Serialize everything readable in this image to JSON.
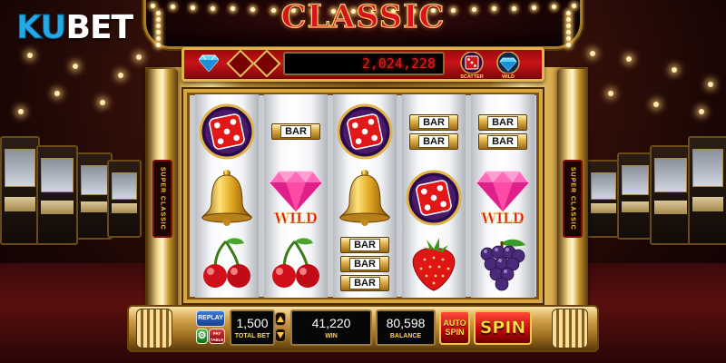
{
  "brand": {
    "logo_text_a": "KU",
    "logo_text_b": "BET"
  },
  "game": {
    "title": "CLASSIC"
  },
  "header": {
    "jackpot": "2,024,228",
    "scatter_label": "SCATTER",
    "wild_label": "WILD"
  },
  "reels": [
    {
      "symbols": [
        "dice",
        "bell",
        "cherry"
      ]
    },
    {
      "symbols": [
        "bar-1",
        "wild-diamond",
        "cherry"
      ]
    },
    {
      "symbols": [
        "dice",
        "bell",
        "bar-3"
      ]
    },
    {
      "symbols": [
        "bar-2",
        "dice",
        "strawberry"
      ]
    },
    {
      "symbols": [
        "bar-2",
        "wild-diamond",
        "grapes"
      ]
    }
  ],
  "symbol_text": {
    "bar": "BAR",
    "wild": "WILD"
  },
  "controls": {
    "replay_label": "REPLAY",
    "paytable_label": "PAY TABLE",
    "total_bet_value": "1,500",
    "total_bet_label": "TOTAL BET",
    "win_value": "41,220",
    "win_label": "WIN",
    "balance_value": "80,598",
    "balance_label": "BALANCE",
    "auto_spin_line1": "AUTO",
    "auto_spin_line2": "SPIN",
    "spin_label": "SPIN"
  },
  "colors": {
    "accent_red": "#c8141a",
    "gold": "#d6a84a",
    "logo_blue": "#23a9e6"
  }
}
